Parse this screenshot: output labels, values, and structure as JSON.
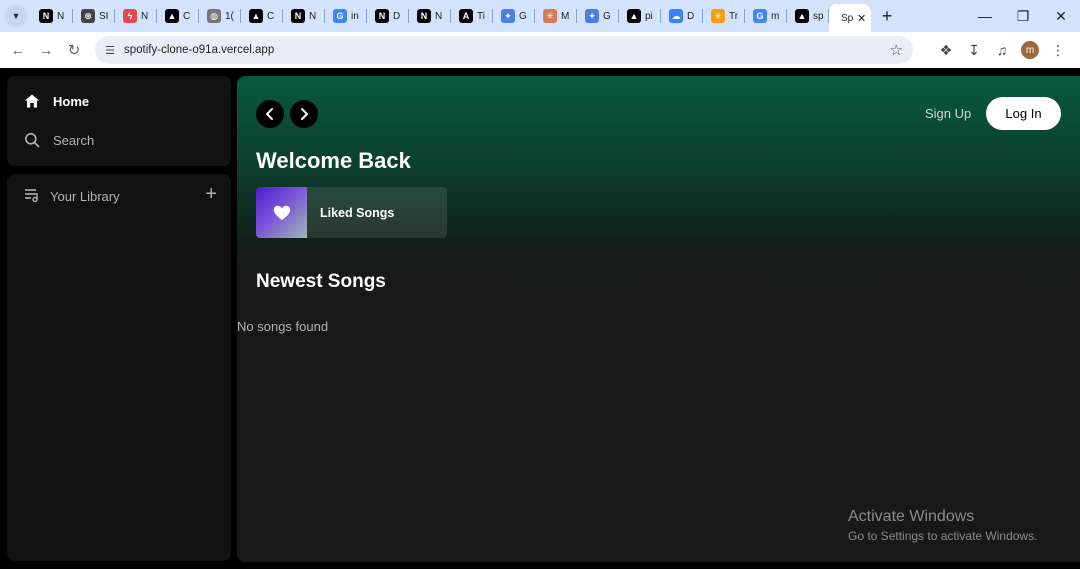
{
  "browser": {
    "tabs": [
      {
        "title": "N",
        "icon": "notion-icon",
        "bg": "#000000",
        "glyph": "N"
      },
      {
        "title": "SI",
        "icon": "openai-icon",
        "bg": "#444444",
        "glyph": "⊛"
      },
      {
        "title": "N",
        "icon": "bolt-icon",
        "bg": "#e5484d",
        "glyph": "ϟ"
      },
      {
        "title": "C",
        "icon": "vercel-icon",
        "bg": "#000000",
        "glyph": "▲"
      },
      {
        "title": "1(",
        "icon": "globe-icon",
        "bg": "#777777",
        "glyph": "◍"
      },
      {
        "title": "C",
        "icon": "vercel-icon",
        "bg": "#000000",
        "glyph": "▲"
      },
      {
        "title": "N",
        "icon": "notion-icon",
        "bg": "#000000",
        "glyph": "N"
      },
      {
        "title": "in",
        "icon": "google-icon",
        "bg": "#4285f4",
        "glyph": "G"
      },
      {
        "title": "D",
        "icon": "notion-icon",
        "bg": "#000000",
        "glyph": "N"
      },
      {
        "title": "N",
        "icon": "nextjs-icon",
        "bg": "#000000",
        "glyph": "N"
      },
      {
        "title": "Ti",
        "icon": "anthropic-icon",
        "bg": "#000000",
        "glyph": "A"
      },
      {
        "title": "G",
        "icon": "gemini-icon",
        "bg": "#4a7fe8",
        "glyph": "✦"
      },
      {
        "title": "M",
        "icon": "claude-icon",
        "bg": "#d97757",
        "glyph": "✳"
      },
      {
        "title": "G",
        "icon": "gemini-icon",
        "bg": "#4a7fe8",
        "glyph": "✦"
      },
      {
        "title": "pi",
        "icon": "vercel-icon",
        "bg": "#000000",
        "glyph": "▲"
      },
      {
        "title": "D",
        "icon": "cloud-icon",
        "bg": "#3b82f6",
        "glyph": "☁"
      },
      {
        "title": "Tr",
        "icon": "claude-icon",
        "bg": "#f59e0b",
        "glyph": "✳"
      },
      {
        "title": "m",
        "icon": "google-icon",
        "bg": "#4285f4",
        "glyph": "G"
      },
      {
        "title": "sp",
        "icon": "vercel-icon",
        "bg": "#000000",
        "glyph": "▲"
      }
    ],
    "active_tab": {
      "title": "Sp"
    },
    "url": "spotify-clone-o91a.vercel.app",
    "avatar_letter": "m"
  },
  "sidebar": {
    "home_label": "Home",
    "search_label": "Search",
    "library_label": "Your Library"
  },
  "header": {
    "signup_label": "Sign Up",
    "login_label": "Log In"
  },
  "main": {
    "welcome": "Welcome Back",
    "liked_songs": "Liked Songs",
    "newest_title": "Newest Songs",
    "empty_message": "No songs found"
  },
  "watermark": {
    "title": "Activate Windows",
    "subtitle": "Go to Settings to activate Windows."
  }
}
